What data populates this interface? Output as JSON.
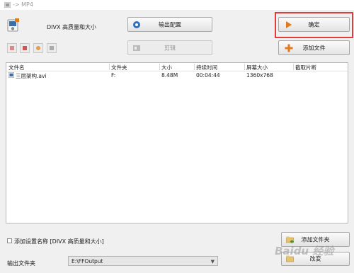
{
  "window": {
    "title": "-> MP4"
  },
  "preset": {
    "name": "DIVX 高质量和大小"
  },
  "buttons": {
    "output_config": "输出配置",
    "confirm": "确定",
    "clip": "剪辑",
    "add_file": "添加文件",
    "add_folder": "添加文件夹",
    "change": "改变"
  },
  "toolbar": {
    "icons": [
      "remove-icon",
      "clear-icon",
      "settings-icon",
      "media-info-icon"
    ]
  },
  "file_table": {
    "columns": [
      "文件名",
      "文件夹",
      "大小",
      "持续时间",
      "屏幕大小",
      "截取片断"
    ],
    "rows": [
      {
        "name": "三层架构.avi",
        "folder": "F:",
        "size": "8.48M",
        "duration": "00:04:44",
        "screen": "1360x768",
        "clip": ""
      }
    ]
  },
  "options": {
    "add_preset_name_label": "添加设置名称 [DIVX 高质量和大小]",
    "add_preset_name_checked": false
  },
  "output": {
    "label": "输出文件夹",
    "folder": "E:\\FFOutput"
  },
  "watermark": {
    "text": "Baidu 经验"
  },
  "colors": {
    "highlight": "#e23b3b"
  }
}
